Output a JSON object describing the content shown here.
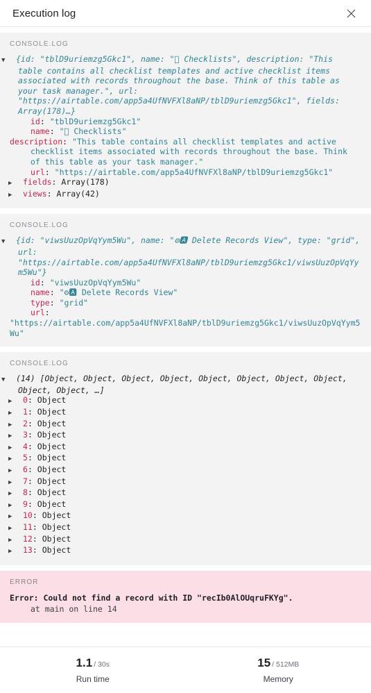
{
  "header": {
    "title": "Execution log",
    "close_icon": "close-icon"
  },
  "log": {
    "blocks": [
      {
        "label": "CONSOLE.LOG",
        "type": "console",
        "preview": {
          "marker": "▼",
          "text": "{id: \"tblD9uriemzg5Gkc1\", name: \" Checklists\", description: \"This table contains all checklist templates and active checklist items associated with records throughout the base. Think of this table as your task manager.\", url: \"https://airtable.com/app5a4UfNVFXl8aNP/tblD9uriemzg5Gkc1\", fields: Array(178)…}"
        },
        "props": [
          {
            "key": "id",
            "value": "\"tblD9uriemzg5Gkc1\"",
            "expandable": false
          },
          {
            "key": "name",
            "value": "\" Checklists\"",
            "expandable": false
          },
          {
            "key": "description",
            "value": "\"This table contains all checklist templates and active checklist items associated with records throughout the base. Think of this table as your task manager.\"",
            "expandable": false
          },
          {
            "key": "url",
            "value": "\"https://airtable.com/app5a4UfNVFXl8aNP/tblD9uriemzg5Gkc1\"",
            "expandable": false
          },
          {
            "key": "fields",
            "value": "Array(178)",
            "expandable": true,
            "marker": "▶"
          },
          {
            "key": "views",
            "value": "Array(42)",
            "expandable": true,
            "marker": "▶"
          }
        ]
      },
      {
        "label": "CONSOLE.LOG",
        "type": "console",
        "preview": {
          "marker": "▼",
          "text": "{id: \"viwsUuzOpVqYym5Wu\", name: \"⚙🅰 Delete Records View\", type: \"grid\", url: \"https://airtable.com/app5a4UfNVFXl8aNP/tblD9uriemzg5Gkc1/viwsUuzOpVqYym5Wu\"}"
        },
        "props": [
          {
            "key": "id",
            "value": "\"viwsUuzOpVqYym5Wu\"",
            "expandable": false
          },
          {
            "key": "name",
            "value": "\"⚙🅰 Delete Records View\"",
            "expandable": false
          },
          {
            "key": "type",
            "value": "\"grid\"",
            "expandable": false
          },
          {
            "key": "url",
            "value": "\"https://airtable.com/app5a4UfNVFXl8aNP/tblD9uriemzg5Gkc1/viwsUuzOpVqYym5Wu\"",
            "expandable": false
          }
        ]
      },
      {
        "label": "CONSOLE.LOG",
        "type": "console-array",
        "preview": {
          "marker": "▼",
          "count": "(14)",
          "text": " [Object, Object, Object, Object, Object, Object, Object, Object, Object, Object, …]"
        },
        "items": [
          {
            "index": "0",
            "value": "Object",
            "marker": "▶"
          },
          {
            "index": "1",
            "value": "Object",
            "marker": "▶"
          },
          {
            "index": "2",
            "value": "Object",
            "marker": "▶"
          },
          {
            "index": "3",
            "value": "Object",
            "marker": "▶"
          },
          {
            "index": "4",
            "value": "Object",
            "marker": "▶"
          },
          {
            "index": "5",
            "value": "Object",
            "marker": "▶"
          },
          {
            "index": "6",
            "value": "Object",
            "marker": "▶"
          },
          {
            "index": "7",
            "value": "Object",
            "marker": "▶"
          },
          {
            "index": "8",
            "value": "Object",
            "marker": "▶"
          },
          {
            "index": "9",
            "value": "Object",
            "marker": "▶"
          },
          {
            "index": "10",
            "value": "Object",
            "marker": "▶"
          },
          {
            "index": "11",
            "value": "Object",
            "marker": "▶"
          },
          {
            "index": "12",
            "value": "Object",
            "marker": "▶"
          },
          {
            "index": "13",
            "value": "Object",
            "marker": "▶"
          }
        ]
      },
      {
        "label": "ERROR",
        "type": "error",
        "message": "Error: Could not find a record with ID \"recIb0AlOUqruFKYg\".",
        "stack": "at main on line 14"
      }
    ]
  },
  "footer": {
    "stats": [
      {
        "value": "1.1",
        "max": "/ 30s",
        "label": "Run time"
      },
      {
        "value": "15",
        "max": "/ 512MB",
        "label": "Memory"
      }
    ]
  },
  "colors": {
    "key": "#c7254e",
    "string": "#318495",
    "block_bg": "#f3f3f3",
    "error_bg": "#fcdfe6",
    "text": "#1d1f25",
    "muted": "#8a8f98"
  }
}
